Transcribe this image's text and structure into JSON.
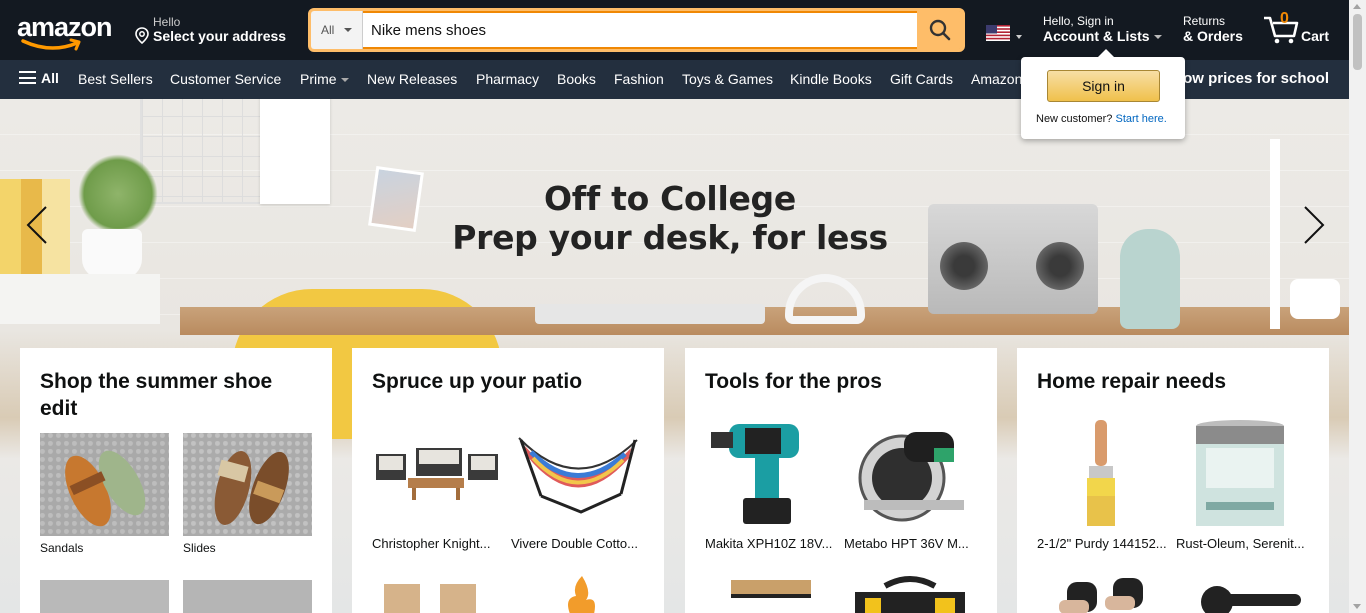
{
  "header": {
    "logo_text": "amazon",
    "deliver": {
      "line1": "Hello",
      "line2": "Select your address"
    },
    "search": {
      "category": "All",
      "value": "Nike mens shoes"
    },
    "account": {
      "line1": "Hello, Sign in",
      "line2": "Account & Lists"
    },
    "returns": {
      "line1": "Returns",
      "line2": "& Orders"
    },
    "cart": {
      "count": "0",
      "label": "Cart"
    }
  },
  "subnav": {
    "all": "All",
    "items": [
      "Best Sellers",
      "Customer Service",
      "Prime",
      "New Releases",
      "Pharmacy",
      "Books",
      "Fashion",
      "Toys & Games",
      "Kindle Books",
      "Gift Cards",
      "Amazon"
    ],
    "promo": "low prices for school"
  },
  "popover": {
    "button": "Sign in",
    "new_customer": "New customer?",
    "start_here": "Start here."
  },
  "hero": {
    "line1": "Off to College",
    "line2": "Prep your desk, for less"
  },
  "cards": [
    {
      "title": "Shop the summer shoe edit",
      "tiles": [
        "Sandals",
        "Slides"
      ]
    },
    {
      "title": "Spruce up your patio",
      "tiles": [
        "Christopher Knight...",
        "Vivere Double Cotto..."
      ]
    },
    {
      "title": "Tools for the pros",
      "tiles": [
        "Makita XPH10Z 18V...",
        "Metabo HPT 36V M..."
      ]
    },
    {
      "title": "Home repair needs",
      "tiles": [
        "2-1/2\" Purdy 144152...",
        "Rust-Oleum, Serenit..."
      ]
    }
  ],
  "colors": {
    "nav_dark": "#131921",
    "nav_sub": "#232f3e",
    "search_accent": "#febd69",
    "cart_orange": "#f08804",
    "link_blue": "#0066c0"
  }
}
